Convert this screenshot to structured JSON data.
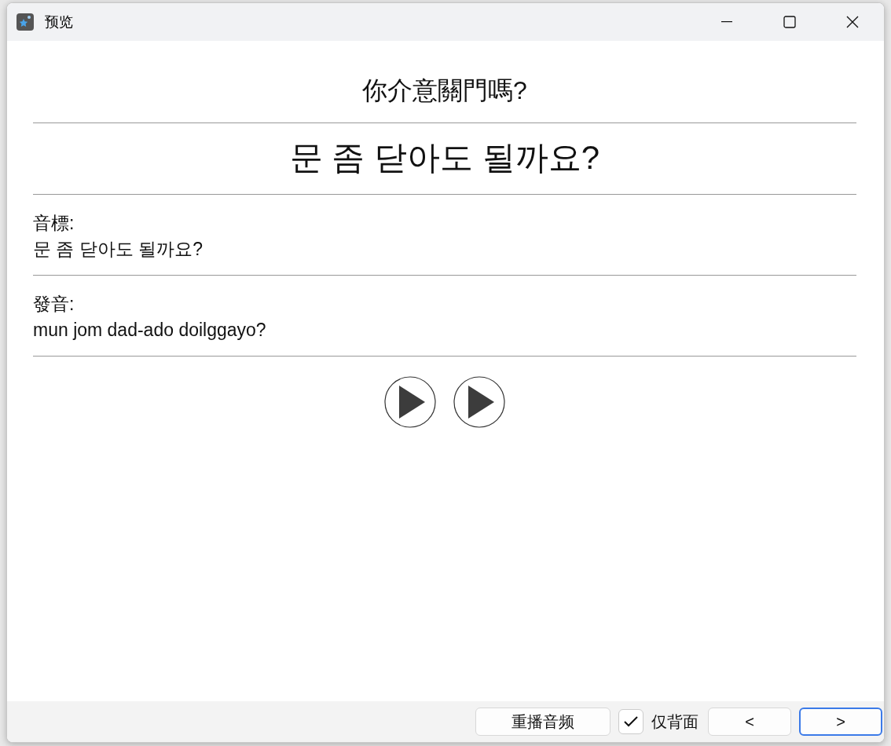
{
  "window": {
    "title": "预览"
  },
  "card": {
    "front": "你介意關門嗎?",
    "back": "문 좀 닫아도 될까요?",
    "fields": [
      {
        "label": "音標:",
        "value": "문 좀 닫아도 될까요?"
      },
      {
        "label": "發音:",
        "value": "mun jom dad-ado doilggayo?"
      }
    ],
    "audio_buttons": [
      {
        "kind": "play"
      },
      {
        "kind": "play"
      }
    ]
  },
  "bottom_bar": {
    "replay": "重播音频",
    "back_only": {
      "label": "仅背面",
      "checked": true
    },
    "prev": "<",
    "next": ">"
  }
}
